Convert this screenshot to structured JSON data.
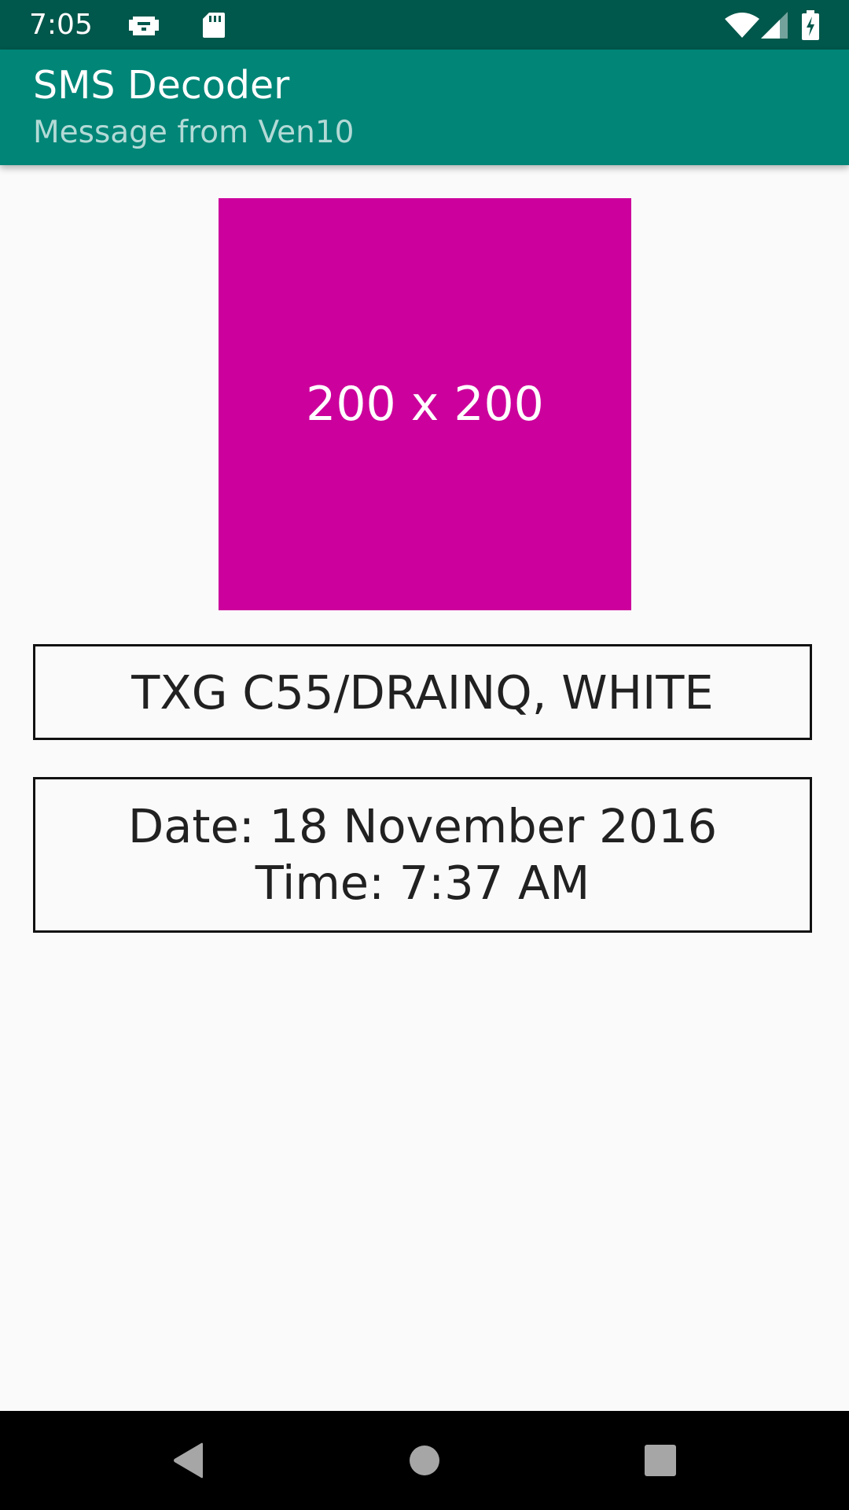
{
  "status_bar": {
    "time": "7:05",
    "left_icons": [
      "android-debug-icon",
      "sd-card-icon"
    ],
    "right_icons": [
      "wifi-icon",
      "signal-icon",
      "battery-charging-icon"
    ],
    "background": "#00574b"
  },
  "app_bar": {
    "title": "SMS Decoder",
    "subtitle": "Message from Ven10",
    "background": "#008577"
  },
  "main": {
    "image": {
      "label": "200 x 200",
      "background": "#cc009c"
    },
    "message": "TXG C55/DRAINQ, WHITE",
    "date_line": "Date: 18 November 2016",
    "time_line": "Time: 7:37 AM"
  },
  "nav_bar": {
    "buttons": [
      "back-icon",
      "home-icon",
      "recents-icon"
    ]
  }
}
